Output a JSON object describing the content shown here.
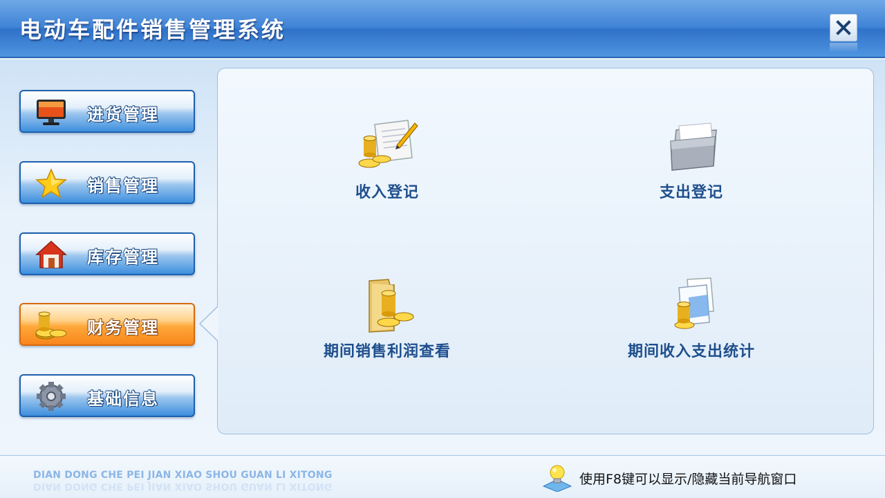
{
  "app": {
    "title": "电动车配件销售管理系统"
  },
  "sidebar": {
    "items": [
      {
        "label": "进货管理",
        "icon": "monitor-icon",
        "active": false
      },
      {
        "label": "销售管理",
        "icon": "star-icon",
        "active": false
      },
      {
        "label": "库存管理",
        "icon": "home-icon",
        "active": false
      },
      {
        "label": "财务管理",
        "icon": "coins-icon",
        "active": true
      },
      {
        "label": "基础信息",
        "icon": "gear-icon",
        "active": false
      }
    ]
  },
  "main": {
    "functions": [
      {
        "label": "收入登记",
        "icon": "income-document-icon"
      },
      {
        "label": "支出登记",
        "icon": "expense-folder-icon"
      },
      {
        "label": "期间销售利润查看",
        "icon": "profit-folder-icon"
      },
      {
        "label": "期间收入支出统计",
        "icon": "statistics-document-icon"
      }
    ]
  },
  "footer": {
    "slogan": "DIAN DONG CHE PEI JIAN XIAO SHOU GUAN LI XITONG",
    "hint": "使用F8键可以显示/隐藏当前导航窗口"
  },
  "colors": {
    "title_bar": "#3f83d6",
    "nav_normal": "#3d8fde",
    "nav_active": "#f7851c",
    "function_label": "#1e4e8c"
  }
}
